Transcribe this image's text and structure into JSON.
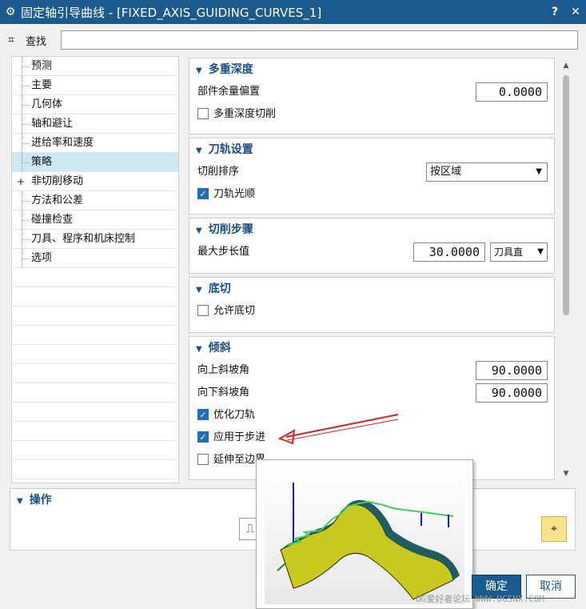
{
  "window": {
    "title": "固定轴引导曲线 - [FIXED_AXIS_GUIDING_CURVES_1]",
    "help": "?",
    "close": "✕"
  },
  "search": {
    "label": "查找",
    "value": ""
  },
  "nav": {
    "items": [
      {
        "label": "预测",
        "expander": "",
        "selected": false
      },
      {
        "label": "主要",
        "expander": "",
        "selected": false
      },
      {
        "label": "几何体",
        "expander": "",
        "selected": false
      },
      {
        "label": "轴和避让",
        "expander": "",
        "selected": false
      },
      {
        "label": "进给率和速度",
        "expander": "",
        "selected": false
      },
      {
        "label": "策略",
        "expander": "",
        "selected": true
      },
      {
        "label": "非切削移动",
        "expander": "+",
        "selected": false
      },
      {
        "label": "方法和公差",
        "expander": "",
        "selected": false
      },
      {
        "label": "碰撞检查",
        "expander": "",
        "selected": false
      },
      {
        "label": "刀具、程序和机床控制",
        "expander": "",
        "selected": false
      },
      {
        "label": "选项",
        "expander": "",
        "selected": false
      }
    ]
  },
  "groups": {
    "multi_depth": {
      "title": "多重深度",
      "part_stock_offset_label": "部件余量偏置",
      "part_stock_offset_value": "0.0000",
      "multi_depth_cut_label": "多重深度切削",
      "multi_depth_cut_checked": false
    },
    "toolpath_settings": {
      "title": "刀轨设置",
      "cut_order_label": "切削排序",
      "cut_order_value": "按区域",
      "toolpath_smooth_label": "刀轨光顺",
      "toolpath_smooth_checked": true
    },
    "stepover": {
      "title": "切削步骤",
      "max_step_label": "最大步长值",
      "max_step_value": "30.0000",
      "max_step_unit": "刀具直"
    },
    "undercut": {
      "title": "底切",
      "allow_undercut_label": "允许底切",
      "allow_undercut_checked": false
    },
    "tilt": {
      "title": "倾斜",
      "ramp_up_label": "向上斜坡角",
      "ramp_up_value": "90.0000",
      "ramp_down_label": "向下斜坡角",
      "ramp_down_value": "90.0000",
      "optimize_label": "优化刀轨",
      "optimize_checked": true,
      "apply_stepover_label": "应用于步进",
      "apply_stepover_checked": true,
      "extend_boundary_label": "延伸至边界",
      "extend_boundary_checked": false
    }
  },
  "operations": {
    "title": "操作"
  },
  "buttons": {
    "ok": "确定",
    "cancel": "取消"
  },
  "watermark": "UG爱好者论坛 WWW.UGSNX.COM",
  "colors": {
    "titlebar": "#1b5a8c",
    "group_header": "#1b4f85",
    "selection": "#cce8f0",
    "checkbox_on": "#1b6ec2",
    "annotation_arrow": "#e02020",
    "preview_part": "#c8c81e"
  }
}
